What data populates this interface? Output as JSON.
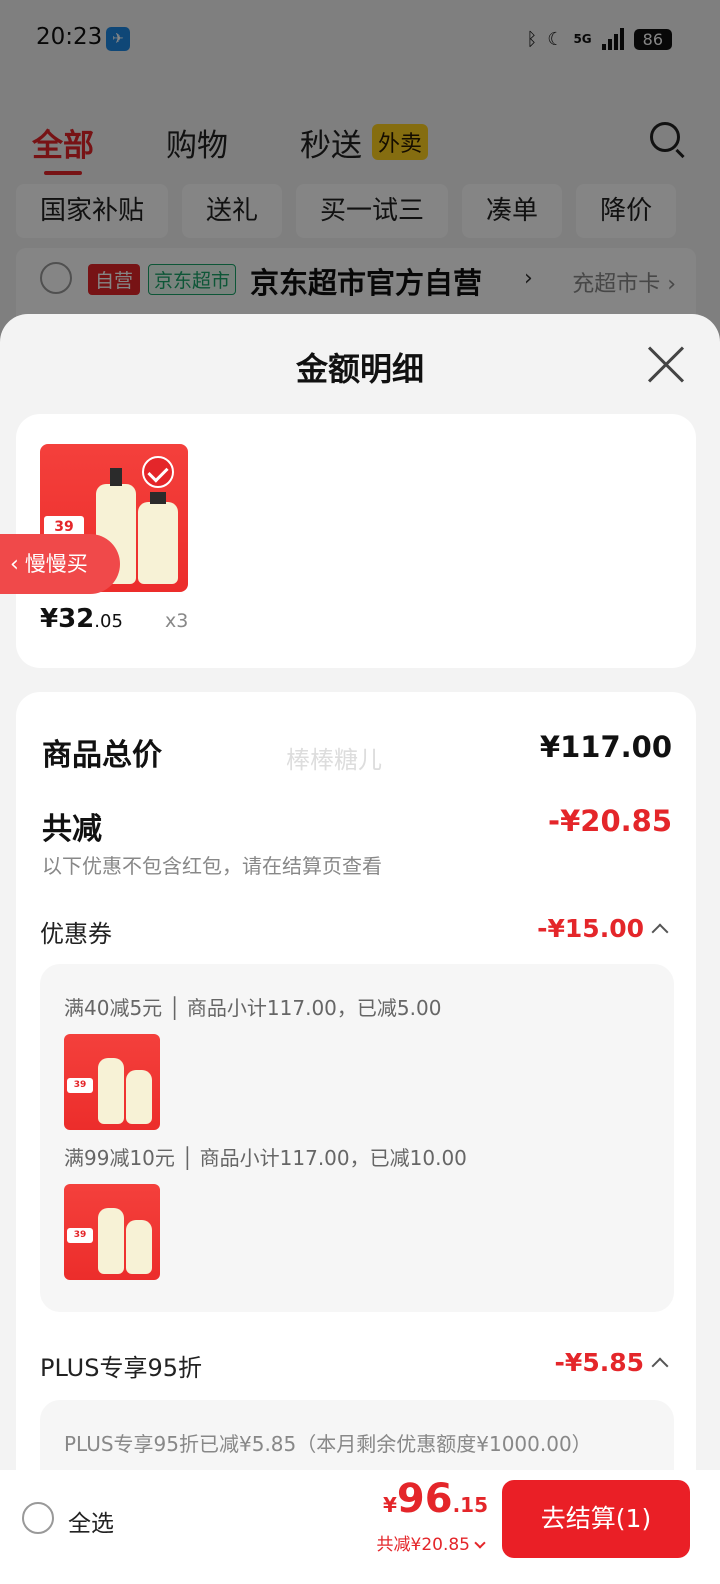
{
  "status": {
    "time": "20:23",
    "network": "5G",
    "battery": "86"
  },
  "tabs": [
    {
      "label": "全部",
      "active": true
    },
    {
      "label": "购物"
    },
    {
      "label": "秒送"
    }
  ],
  "tab_badge": "外卖",
  "chips": [
    "国家补贴",
    "送礼",
    "买一试三",
    "凑单",
    "降价"
  ],
  "shop": {
    "badge_self": "自营",
    "badge_super": "京东超市",
    "name": "京东超市官方自营",
    "card_link": "充超市卡"
  },
  "sheet": {
    "title": "金额明细",
    "product": {
      "price_int": "¥32",
      "price_dec": ".05",
      "qty": "x3"
    },
    "slow_buy": "慢慢买",
    "total_label": "商品总价",
    "total_value": "¥117.00",
    "watermark": "棒棒糖儿",
    "discount_label": "共减",
    "discount_value": "-¥20.85",
    "hint": "以下优惠不包含红包，请在结算页查看",
    "coupon_label": "优惠券",
    "coupon_value": "-¥15.00",
    "coupons": [
      "满40减5元 │ 商品小计117.00，已减5.00",
      "满99减10元 │ 商品小计117.00，已减10.00"
    ],
    "plus_label": "PLUS专享95折",
    "plus_value": "-¥5.85",
    "plus_detail": "PLUS专享95折已减¥5.85（本月剩余优惠额度¥1000.00）"
  },
  "bottom": {
    "select_all": "全选",
    "total_yen": "¥",
    "total_int": "96",
    "total_dec": ".15",
    "saved": "共减¥20.85",
    "checkout": "去结算(1)"
  }
}
